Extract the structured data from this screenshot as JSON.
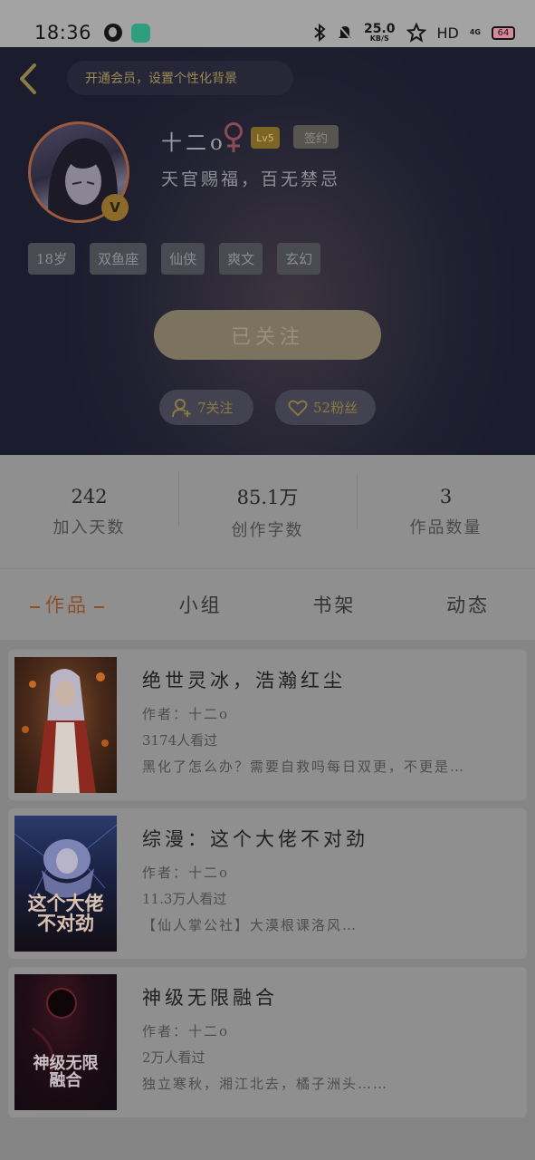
{
  "status_bar": {
    "time": "18:36",
    "speed_value": "25.0",
    "speed_unit": "KB/S",
    "hd": "HD",
    "network": "4G",
    "battery": "64"
  },
  "header": {
    "vip_banner": "开通会员，设置个性化背景",
    "username": "十二o",
    "level": "Lv5",
    "contract_badge": "签约",
    "bio": "天官赐福，百无禁忌",
    "verified": "V",
    "tags": [
      "18岁",
      "双鱼座",
      "仙侠",
      "爽文",
      "玄幻"
    ],
    "follow_button": "已关注",
    "following": "7关注",
    "fans": "52粉丝"
  },
  "stats": [
    {
      "value": "242",
      "label": "加入天数"
    },
    {
      "value": "85.1万",
      "label": "创作字数"
    },
    {
      "value": "3",
      "label": "作品数量"
    }
  ],
  "tabs": [
    {
      "label": "作品"
    },
    {
      "label": "小组"
    },
    {
      "label": "书架"
    },
    {
      "label": "动态"
    }
  ],
  "books": [
    {
      "title": "绝世灵冰，浩瀚红尘",
      "author": "作者：十二o",
      "views": "3174人看过",
      "desc": "黑化了怎么办？需要自救吗每日双更，不更是…"
    },
    {
      "title": "综漫：这个大佬不对劲",
      "author": "作者：十二o",
      "views": "11.3万人看过",
      "desc": "【仙人掌公社】大漠根课洛风…",
      "cover_text": "这个大佬不对劲"
    },
    {
      "title": "神级无限融合",
      "author": "作者：十二o",
      "views": "2万人看过",
      "desc": "独立寒秋，湘江北去，橘子洲头……",
      "cover_text": "神级无限融合"
    }
  ],
  "colors": {
    "accent": "#8f4d28",
    "gold": "#8c7a44",
    "header_bg": "#1f1f30"
  }
}
